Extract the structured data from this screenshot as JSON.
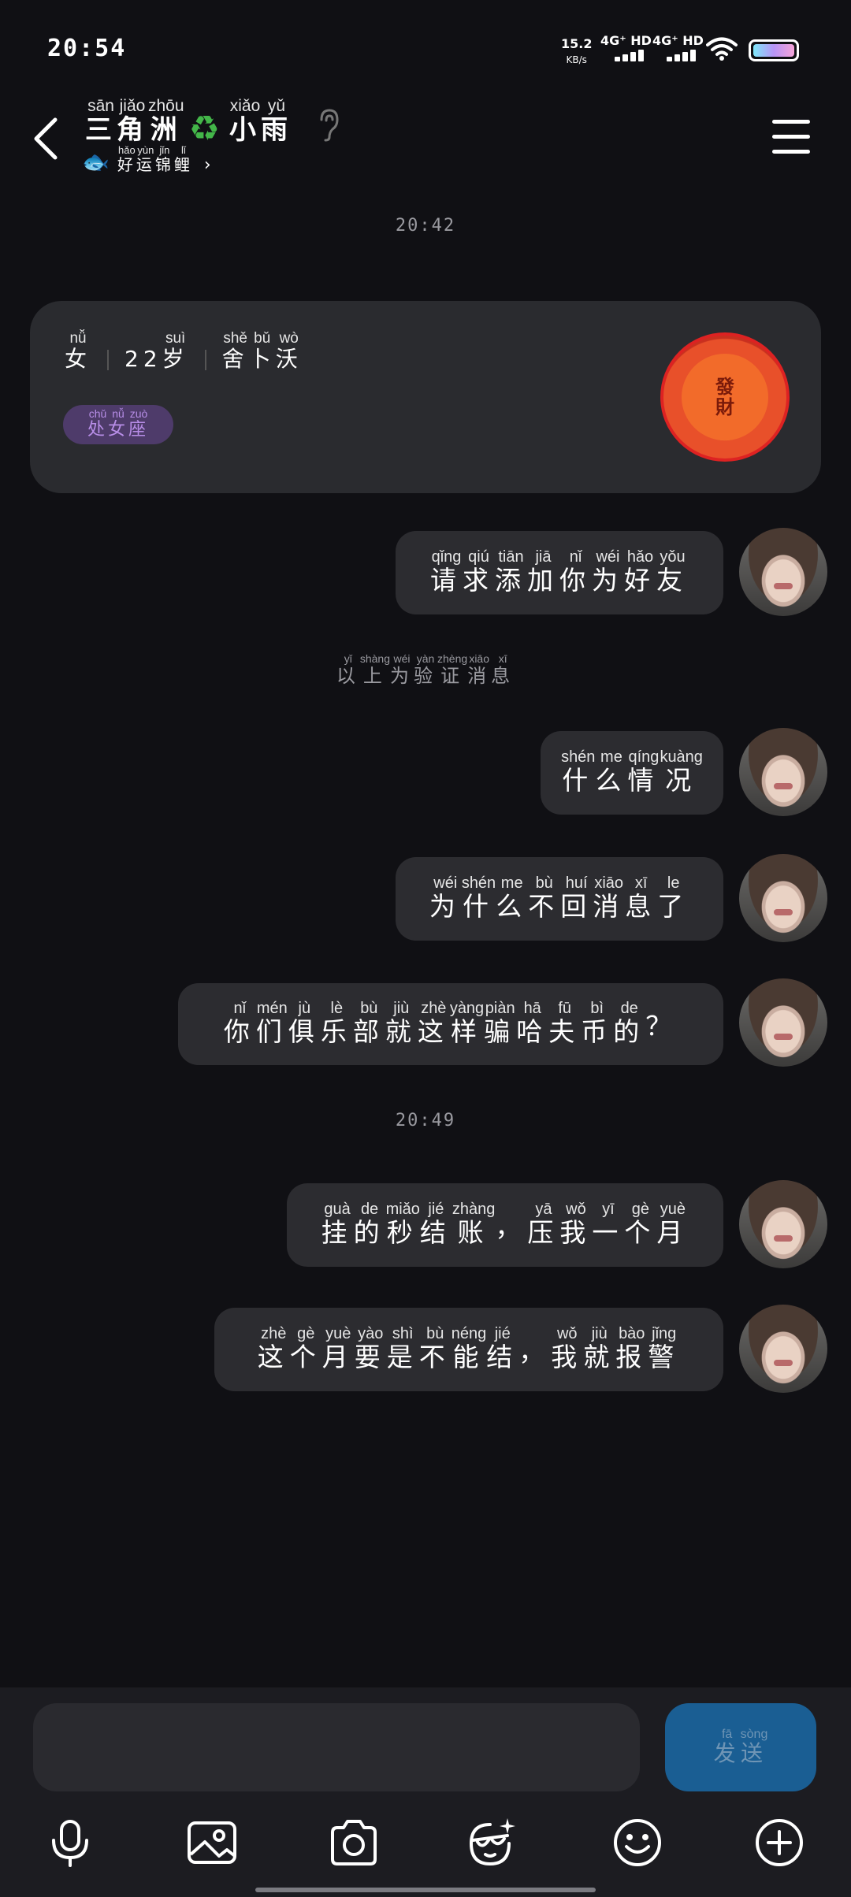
{
  "status_bar": {
    "time": "20:54",
    "speed_value": "15.2",
    "speed_unit": "KB/s",
    "net1": "4G⁺ HD",
    "net2": "4G⁺ HD"
  },
  "header": {
    "title_chars": [
      {
        "c": "三",
        "p": "sān"
      },
      {
        "c": "角",
        "p": "jiǎo"
      },
      {
        "c": "洲",
        "p": "zhōu"
      },
      {
        "c": "♻",
        "p": ""
      },
      {
        "c": "小",
        "p": "xiǎo"
      },
      {
        "c": "雨",
        "p": "yǔ"
      }
    ],
    "subtitle_chars": [
      {
        "c": "好",
        "p": "hǎo"
      },
      {
        "c": "运",
        "p": "yùn"
      },
      {
        "c": "锦",
        "p": "jǐn"
      },
      {
        "c": "鲤",
        "p": "lǐ"
      }
    ],
    "chevron": "›"
  },
  "timestamps": [
    "20:42",
    "20:49"
  ],
  "profile_card": {
    "gender": {
      "c": "女",
      "p": "nǚ"
    },
    "age_num": "22",
    "age_unit": {
      "c": "岁",
      "p": "suì"
    },
    "name_chars": [
      {
        "c": "舍",
        "p": "shě"
      },
      {
        "c": "卜",
        "p": "bǔ"
      },
      {
        "c": "沃",
        "p": "wò"
      }
    ],
    "zodiac_chars": [
      {
        "c": "处",
        "p": "chǔ"
      },
      {
        "c": "女",
        "p": "nǚ"
      },
      {
        "c": "座",
        "p": "zuò"
      }
    ],
    "badge_text": [
      "發",
      "財"
    ]
  },
  "verify_note": [
    {
      "c": "以",
      "p": "yǐ"
    },
    {
      "c": "上",
      "p": "shàng"
    },
    {
      "c": "为",
      "p": "wéi"
    },
    {
      "c": "验",
      "p": "yàn"
    },
    {
      "c": "证",
      "p": "zhèng"
    },
    {
      "c": "消",
      "p": "xiāo"
    },
    {
      "c": "息",
      "p": "xī"
    }
  ],
  "messages": [
    {
      "chars": [
        {
          "c": "请",
          "p": "qǐng"
        },
        {
          "c": "求",
          "p": "qiú"
        },
        {
          "c": "添",
          "p": "tiān"
        },
        {
          "c": "加",
          "p": "jiā"
        },
        {
          "c": "你",
          "p": "nǐ"
        },
        {
          "c": "为",
          "p": "wéi"
        },
        {
          "c": "好",
          "p": "hǎo"
        },
        {
          "c": "友",
          "p": "yǒu"
        }
      ]
    },
    {
      "chars": [
        {
          "c": "什",
          "p": "shén"
        },
        {
          "c": "么",
          "p": "me"
        },
        {
          "c": "情",
          "p": "qíng"
        },
        {
          "c": "况",
          "p": "kuàng"
        }
      ]
    },
    {
      "chars": [
        {
          "c": "为",
          "p": "wéi"
        },
        {
          "c": "什",
          "p": "shén"
        },
        {
          "c": "么",
          "p": "me"
        },
        {
          "c": "不",
          "p": "bù"
        },
        {
          "c": "回",
          "p": "huí"
        },
        {
          "c": "消",
          "p": "xiāo"
        },
        {
          "c": "息",
          "p": "xī"
        },
        {
          "c": "了",
          "p": "le"
        }
      ]
    },
    {
      "chars": [
        {
          "c": "你",
          "p": "nǐ"
        },
        {
          "c": "们",
          "p": "mén"
        },
        {
          "c": "俱",
          "p": "jù"
        },
        {
          "c": "乐",
          "p": "lè"
        },
        {
          "c": "部",
          "p": "bù"
        },
        {
          "c": "就",
          "p": "jiù"
        },
        {
          "c": "这",
          "p": "zhè"
        },
        {
          "c": "样",
          "p": "yàng"
        },
        {
          "c": "骗",
          "p": "piàn"
        },
        {
          "c": "哈",
          "p": "hā"
        },
        {
          "c": "夫",
          "p": "fū"
        },
        {
          "c": "币",
          "p": "bì"
        },
        {
          "c": "的",
          "p": "de"
        },
        {
          "c": "？",
          "p": ""
        }
      ]
    },
    {
      "chars": [
        {
          "c": "挂",
          "p": "guà"
        },
        {
          "c": "的",
          "p": "de"
        },
        {
          "c": "秒",
          "p": "miǎo"
        },
        {
          "c": "结",
          "p": "jié"
        },
        {
          "c": "账",
          "p": "zhàng"
        },
        {
          "c": "，",
          "p": ""
        },
        {
          "c": "压",
          "p": "yā"
        },
        {
          "c": "我",
          "p": "wǒ"
        },
        {
          "c": "一",
          "p": "yī"
        },
        {
          "c": "个",
          "p": "gè"
        },
        {
          "c": "月",
          "p": "yuè"
        }
      ]
    },
    {
      "chars": [
        {
          "c": "这",
          "p": "zhè"
        },
        {
          "c": "个",
          "p": "gè"
        },
        {
          "c": "月",
          "p": "yuè"
        },
        {
          "c": "要",
          "p": "yào"
        },
        {
          "c": "是",
          "p": "shì"
        },
        {
          "c": "不",
          "p": "bù"
        },
        {
          "c": "能",
          "p": "néng"
        },
        {
          "c": "结",
          "p": "jié"
        },
        {
          "c": "，",
          "p": ""
        },
        {
          "c": "我",
          "p": "wǒ"
        },
        {
          "c": "就",
          "p": "jiù"
        },
        {
          "c": "报",
          "p": "bào"
        },
        {
          "c": "警",
          "p": "jǐng"
        }
      ]
    }
  ],
  "composer": {
    "send_chars": [
      {
        "c": "发",
        "p": "fā"
      },
      {
        "c": "送",
        "p": "sòng"
      }
    ],
    "tools": [
      "microphone-icon",
      "image-icon",
      "camera-icon",
      "face-sparkle-icon",
      "emoji-icon",
      "plus-icon"
    ]
  }
}
